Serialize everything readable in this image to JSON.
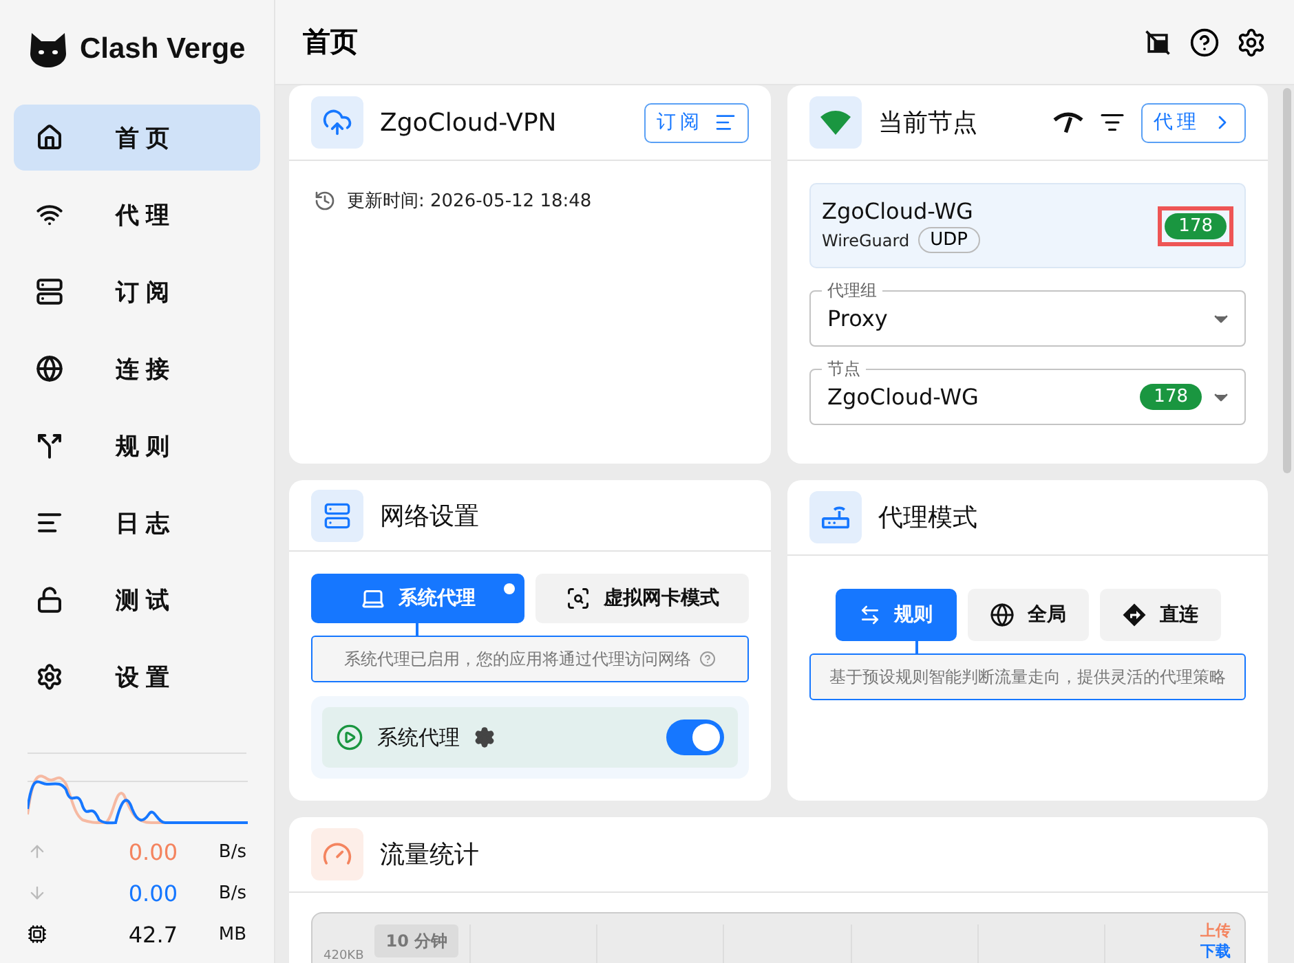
{
  "app": {
    "name": "Clash Verge"
  },
  "nav": [
    {
      "label": "首页",
      "kind": "home",
      "selected": true
    },
    {
      "label": "代理",
      "kind": "proxy",
      "selected": false
    },
    {
      "label": "订阅",
      "kind": "profiles",
      "selected": false
    },
    {
      "label": "连接",
      "kind": "connections",
      "selected": false
    },
    {
      "label": "规则",
      "kind": "rules",
      "selected": false
    },
    {
      "label": "日志",
      "kind": "logs",
      "selected": false
    },
    {
      "label": "测试",
      "kind": "test",
      "selected": false
    },
    {
      "label": "设置",
      "kind": "settings",
      "selected": false
    }
  ],
  "sidebar_stats": [
    {
      "kind": "up",
      "value": "0.00",
      "unit": "B/s"
    },
    {
      "kind": "down",
      "value": "0.00",
      "unit": "B/s"
    },
    {
      "kind": "memory",
      "value": "42.7",
      "unit": "MB"
    }
  ],
  "page_title": "首页",
  "profile_card": {
    "title": "ZgoCloud-VPN",
    "button": "订阅",
    "update_label": "更新时间: 2026-05-12 18:48"
  },
  "node_card": {
    "title": "当前节点",
    "button": "代理",
    "current": {
      "name": "ZgoCloud-WG",
      "type": "WireGuard",
      "tag": "UDP",
      "delay": "178",
      "highlighted": true
    },
    "group_field": {
      "label": "代理组",
      "value": "Proxy"
    },
    "node_field": {
      "label": "节点",
      "value": "ZgoCloud-WG",
      "delay": "178"
    }
  },
  "network_card": {
    "title": "网络设置",
    "modes": [
      {
        "label": "系统代理",
        "kind": "system",
        "selected": true,
        "dot": true
      },
      {
        "label": "虚拟网卡模式",
        "kind": "tun",
        "selected": false,
        "dot": false
      }
    ],
    "hint": "系统代理已启用，您的应用将通过代理访问网络",
    "toggle": {
      "label": "系统代理",
      "on": true
    }
  },
  "mode_card": {
    "title": "代理模式",
    "modes": [
      {
        "label": "规则",
        "kind": "rule",
        "selected": true
      },
      {
        "label": "全局",
        "kind": "global",
        "selected": false
      },
      {
        "label": "直连",
        "kind": "direct",
        "selected": false
      }
    ],
    "hint": "基于预设规则智能判断流量走向，提供灵活的代理策略"
  },
  "traffic_card": {
    "title": "流量统计",
    "range": "10 分钟",
    "y_label": "420KB",
    "legend": [
      {
        "label": "上传",
        "color": "#f4845f"
      },
      {
        "label": "下载",
        "color": "#1677ff"
      }
    ]
  }
}
